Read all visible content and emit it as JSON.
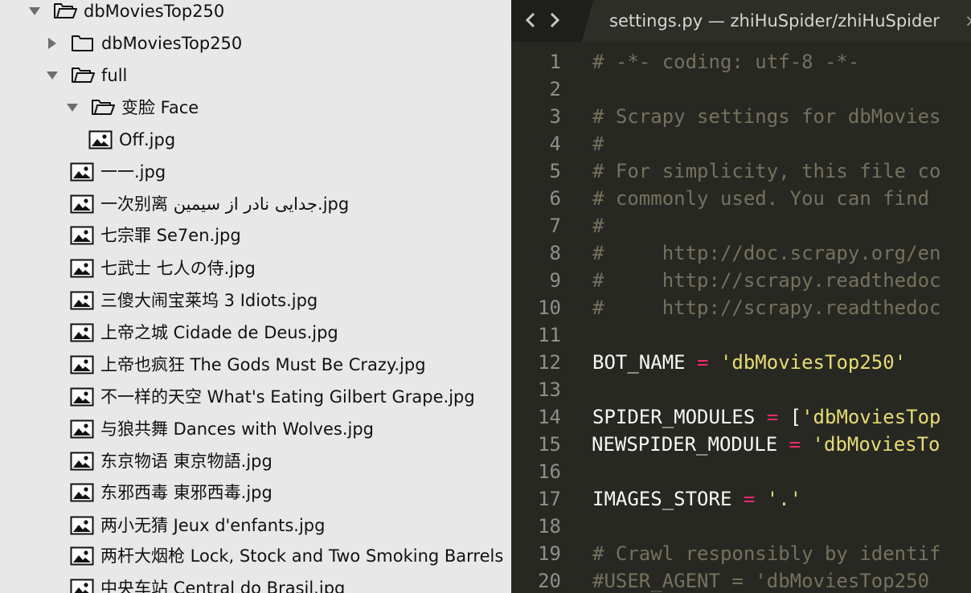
{
  "sidebar": {
    "items": [
      {
        "label": "dbMoviesTop250",
        "type": "folder",
        "state": "open",
        "icon": "folder-open-icon"
      },
      {
        "label": "dbMoviesTop250",
        "type": "folder",
        "state": "closed",
        "icon": "folder-icon"
      },
      {
        "label": "full",
        "type": "folder",
        "state": "open",
        "icon": "folder-open-icon"
      },
      {
        "label": "变脸 Face",
        "type": "folder",
        "state": "open",
        "icon": "folder-open-icon"
      },
      {
        "label": "Off.jpg",
        "type": "file",
        "icon": "image-file-icon"
      },
      {
        "label": "一一.jpg",
        "type": "file",
        "icon": "image-file-icon"
      },
      {
        "label": "一次别离 جدایی نادر از سیمین.jpg",
        "type": "file",
        "icon": "image-file-icon"
      },
      {
        "label": "七宗罪 Se7en.jpg",
        "type": "file",
        "icon": "image-file-icon"
      },
      {
        "label": "七武士 七人の侍.jpg",
        "type": "file",
        "icon": "image-file-icon"
      },
      {
        "label": "三傻大闹宝莱坞 3 Idiots.jpg",
        "type": "file",
        "icon": "image-file-icon"
      },
      {
        "label": "上帝之城 Cidade de Deus.jpg",
        "type": "file",
        "icon": "image-file-icon"
      },
      {
        "label": "上帝也疯狂 The Gods Must Be Crazy.jpg",
        "type": "file",
        "icon": "image-file-icon"
      },
      {
        "label": "不一样的天空 What's Eating Gilbert Grape.jpg",
        "type": "file",
        "icon": "image-file-icon"
      },
      {
        "label": "与狼共舞 Dances with Wolves.jpg",
        "type": "file",
        "icon": "image-file-icon"
      },
      {
        "label": "东京物语 東京物語.jpg",
        "type": "file",
        "icon": "image-file-icon"
      },
      {
        "label": "东邪西毒 東邪西毒.jpg",
        "type": "file",
        "icon": "image-file-icon"
      },
      {
        "label": "两小无猜 Jeux d'enfants.jpg",
        "type": "file",
        "icon": "image-file-icon"
      },
      {
        "label": "两杆大烟枪 Lock, Stock and Two Smoking Barrels",
        "type": "file",
        "icon": "image-file-icon"
      },
      {
        "label": "中央车站 Central do Brasil.jpg",
        "type": "file",
        "icon": "image-file-icon"
      }
    ]
  },
  "editor": {
    "tab_title": "settings.py — zhiHuSpider/zhiHuSpider",
    "tab_close_glyph": "×",
    "nav_back_icon": "chevron-left-icon",
    "nav_forward_icon": "chevron-right-icon",
    "lines": [
      {
        "num": "1",
        "tokens": [
          {
            "t": "# -*- coding: utf-8 -*-",
            "k": "comment"
          }
        ]
      },
      {
        "num": "2",
        "tokens": []
      },
      {
        "num": "3",
        "tokens": [
          {
            "t": "# Scrapy settings for dbMovies",
            "k": "comment"
          }
        ]
      },
      {
        "num": "4",
        "tokens": [
          {
            "t": "#",
            "k": "comment"
          }
        ]
      },
      {
        "num": "5",
        "tokens": [
          {
            "t": "# For simplicity, this file co",
            "k": "comment"
          }
        ]
      },
      {
        "num": "6",
        "tokens": [
          {
            "t": "# commonly used. You can find",
            "k": "comment"
          }
        ]
      },
      {
        "num": "7",
        "tokens": [
          {
            "t": "#",
            "k": "comment"
          }
        ]
      },
      {
        "num": "8",
        "tokens": [
          {
            "t": "#     http://doc.scrapy.org/en",
            "k": "comment"
          }
        ]
      },
      {
        "num": "9",
        "tokens": [
          {
            "t": "#     http://scrapy.readthedoc",
            "k": "comment"
          }
        ]
      },
      {
        "num": "10",
        "tokens": [
          {
            "t": "#     http://scrapy.readthedoc",
            "k": "comment"
          }
        ]
      },
      {
        "num": "11",
        "tokens": []
      },
      {
        "num": "12",
        "tokens": [
          {
            "t": "BOT_NAME",
            "k": "name"
          },
          {
            "t": " ",
            "k": "punc"
          },
          {
            "t": "=",
            "k": "op"
          },
          {
            "t": " ",
            "k": "punc"
          },
          {
            "t": "'dbMoviesTop250'",
            "k": "str"
          }
        ]
      },
      {
        "num": "13",
        "tokens": []
      },
      {
        "num": "14",
        "tokens": [
          {
            "t": "SPIDER_MODULES",
            "k": "name"
          },
          {
            "t": " ",
            "k": "punc"
          },
          {
            "t": "=",
            "k": "op"
          },
          {
            "t": " [",
            "k": "punc"
          },
          {
            "t": "'dbMoviesTop",
            "k": "str"
          }
        ]
      },
      {
        "num": "15",
        "tokens": [
          {
            "t": "NEWSPIDER_MODULE",
            "k": "name"
          },
          {
            "t": " ",
            "k": "punc"
          },
          {
            "t": "=",
            "k": "op"
          },
          {
            "t": " ",
            "k": "punc"
          },
          {
            "t": "'dbMoviesTo",
            "k": "str"
          }
        ]
      },
      {
        "num": "16",
        "tokens": []
      },
      {
        "num": "17",
        "tokens": [
          {
            "t": "IMAGES_STORE",
            "k": "name"
          },
          {
            "t": " ",
            "k": "punc"
          },
          {
            "t": "=",
            "k": "op"
          },
          {
            "t": " ",
            "k": "punc"
          },
          {
            "t": "'.'",
            "k": "str"
          }
        ]
      },
      {
        "num": "18",
        "tokens": []
      },
      {
        "num": "19",
        "tokens": [
          {
            "t": "# Crawl responsibly by identif",
            "k": "comment"
          }
        ]
      },
      {
        "num": "20",
        "tokens": [
          {
            "t": "#USER_AGENT = 'dbMoviesTop250",
            "k": "comment"
          }
        ]
      }
    ]
  },
  "colors": {
    "sidebar_bg": "#e8e8e8",
    "editor_bg": "#272822",
    "comment": "#75715e",
    "keyword_op": "#f92672",
    "string": "#e6db74",
    "text": "#f8f8f2",
    "gutter": "#8f908a"
  }
}
